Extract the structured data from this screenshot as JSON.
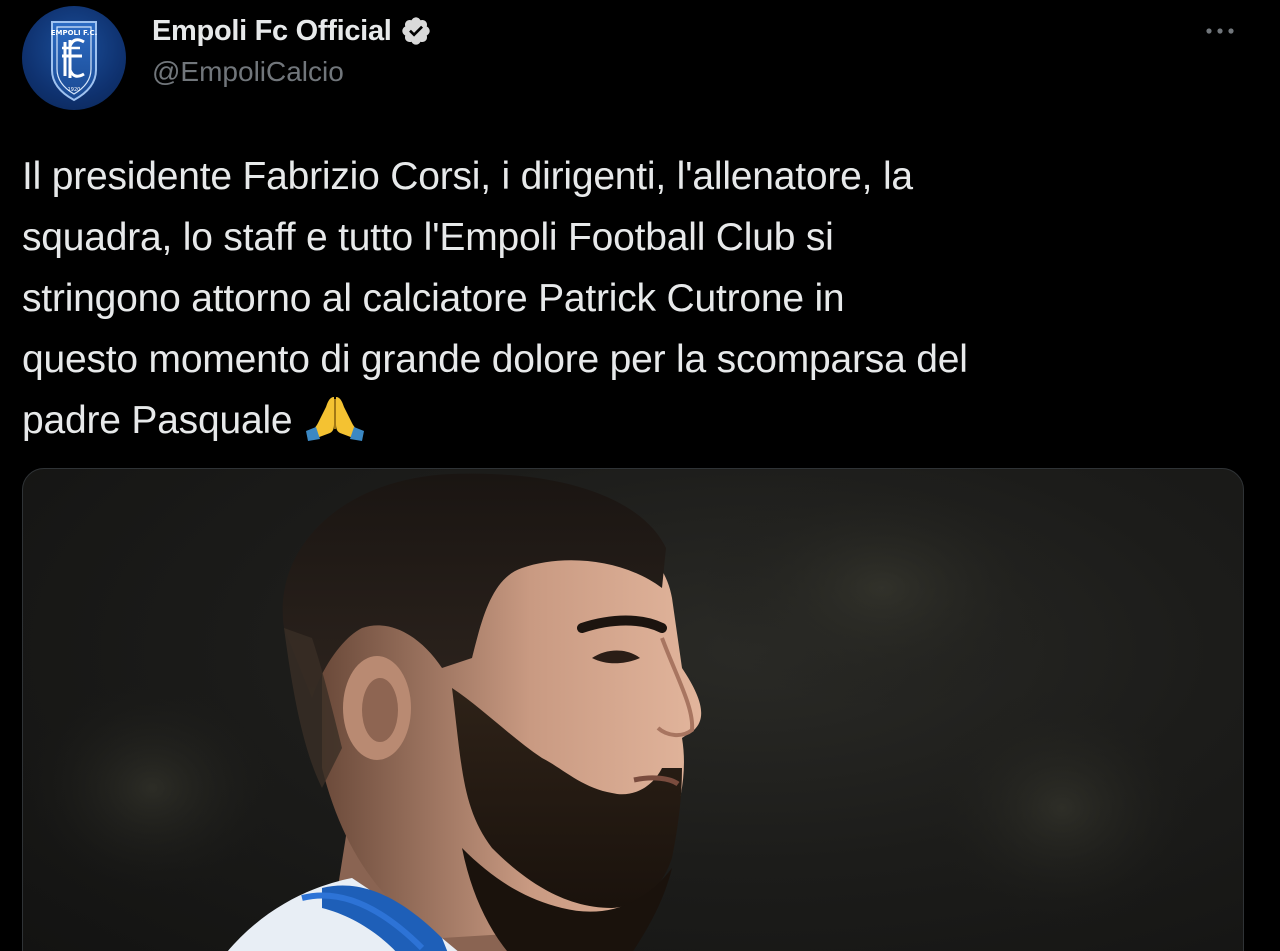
{
  "author": {
    "display_name": "Empoli Fc Official",
    "handle": "@EmpoliCalcio",
    "verified": true,
    "avatar_icon": "empoli-crest-icon",
    "avatar_text": "EMPOLI F.C.",
    "avatar_year": "1920"
  },
  "menu": {
    "icon": "more-horizontal-icon"
  },
  "tweet": {
    "lines": [
      "Il presidente Fabrizio Corsi, i dirigenti, l'allenatore, la",
      "squadra, lo staff e tutto l'Empoli Football Club si",
      "stringono attorno al calciatore Patrick Cutrone in",
      "questo momento di grande dolore per la scomparsa del",
      "padre Pasquale"
    ],
    "emoji": "folded-hands-icon"
  },
  "media": {
    "type": "photo",
    "subject": "player-portrait"
  },
  "colors": {
    "background": "#000000",
    "text_primary": "#e7e9ea",
    "text_secondary": "#71767b",
    "crest_blue": "#1b4f9a",
    "verified_badge": "#d9d9d9"
  }
}
